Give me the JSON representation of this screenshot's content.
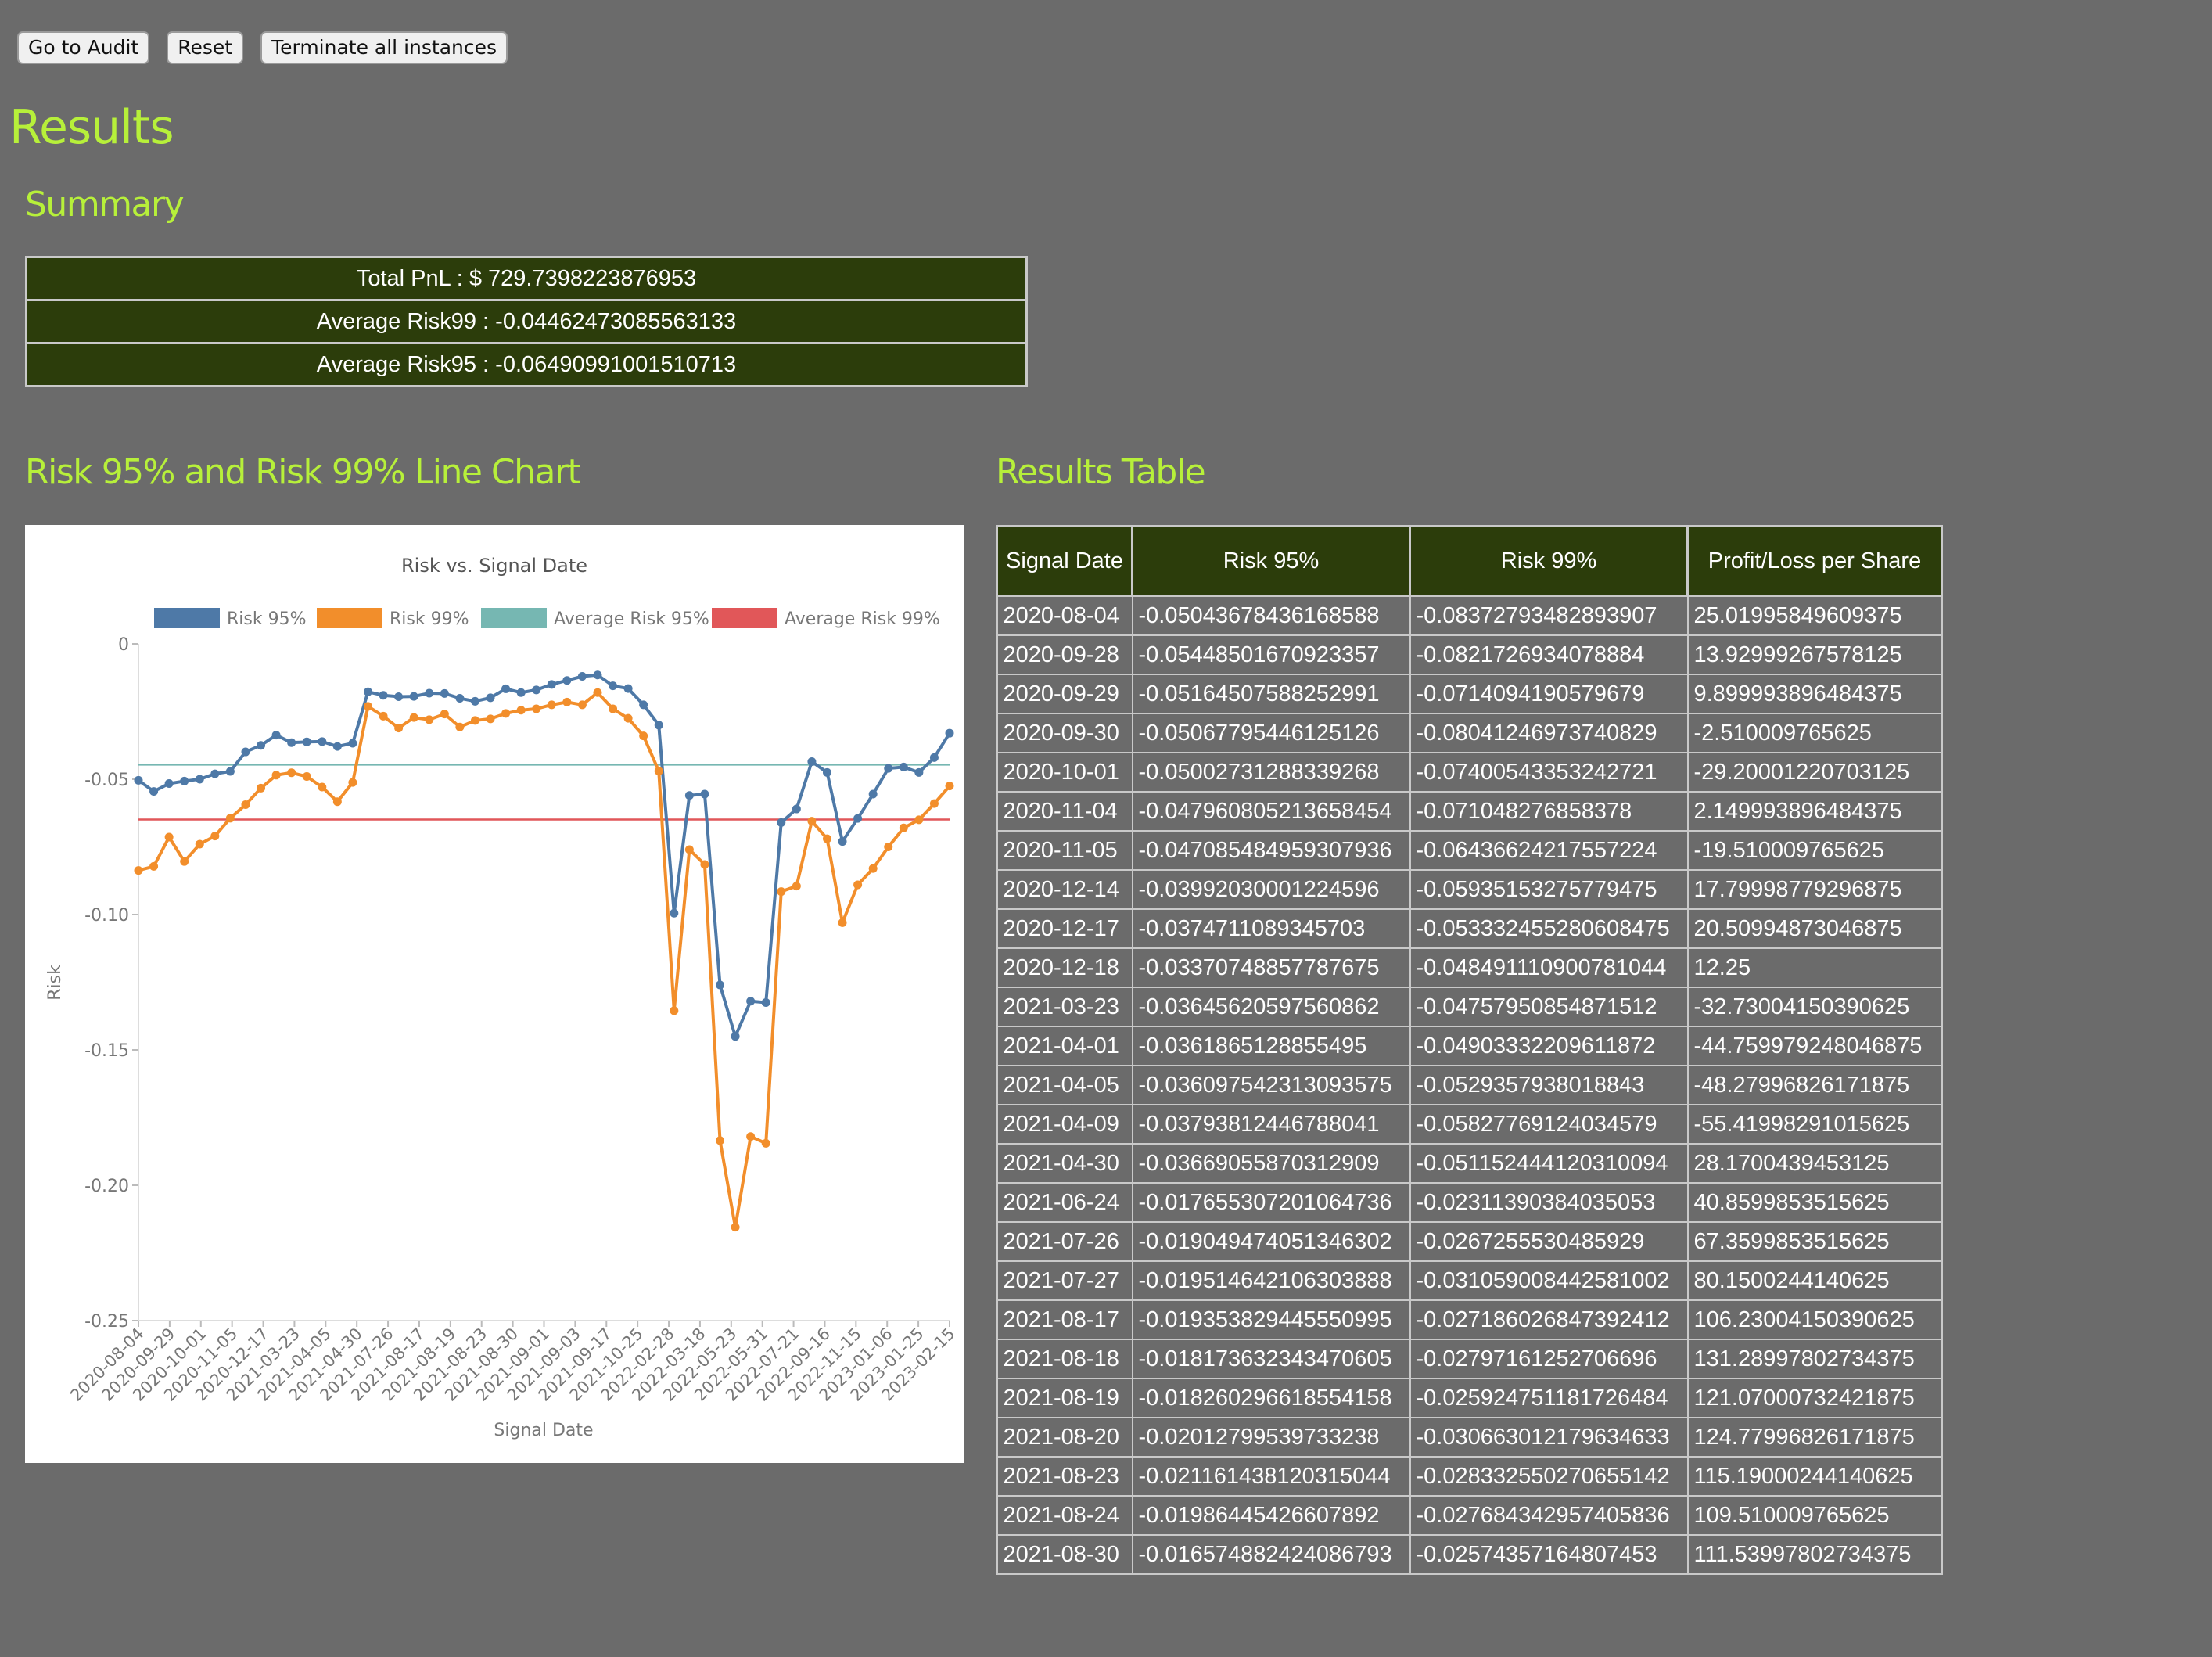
{
  "toolbar": {
    "audit_label": "Go to Audit",
    "reset_label": "Reset",
    "terminate_label": "Terminate all instances"
  },
  "page_title": "Results",
  "summary": {
    "heading": "Summary",
    "total_pnl": "Total PnL : $ 729.7398223876953",
    "avg_risk99": "Average Risk99 : -0.04462473085563133",
    "avg_risk95": "Average Risk95 : -0.06490991001510713"
  },
  "chart_section": {
    "heading": "Risk 95% and Risk 99% Line Chart"
  },
  "table_section": {
    "heading": "Results Table"
  },
  "table": {
    "headers": [
      "Signal Date",
      "Risk 95%",
      "Risk 99%",
      "Profit/Loss per Share"
    ],
    "rows": [
      [
        "2020-08-04",
        "-0.05043678436168588",
        "-0.08372793482893907",
        "25.01995849609375"
      ],
      [
        "2020-09-28",
        "-0.05448501670923357",
        "-0.0821726934078884",
        "13.92999267578125"
      ],
      [
        "2020-09-29",
        "-0.05164507588252991",
        "-0.0714094190579679",
        "9.899993896484375"
      ],
      [
        "2020-09-30",
        "-0.05067795446125126",
        "-0.08041246973740829",
        "-2.510009765625"
      ],
      [
        "2020-10-01",
        "-0.05002731288339268",
        "-0.07400543353242721",
        "-29.20001220703125"
      ],
      [
        "2020-11-04",
        "-0.047960805213658454",
        "-0.071048276858378",
        "2.149993896484375"
      ],
      [
        "2020-11-05",
        "-0.047085484959307936",
        "-0.06436624217557224",
        "-19.510009765625"
      ],
      [
        "2020-12-14",
        "-0.03992030001224596",
        "-0.05935153275779475",
        "17.79998779296875"
      ],
      [
        "2020-12-17",
        "-0.0374711089345703",
        "-0.053332455280608475",
        "20.50994873046875"
      ],
      [
        "2020-12-18",
        "-0.03370748857787675",
        "-0.048491110900781044",
        "12.25"
      ],
      [
        "2021-03-23",
        "-0.03645620597560862",
        "-0.04757950854871512",
        "-32.73004150390625"
      ],
      [
        "2021-04-01",
        "-0.0361865128855495",
        "-0.04903332209611872",
        "-44.759979248046875"
      ],
      [
        "2021-04-05",
        "-0.036097542313093575",
        "-0.0529357938018843",
        "-48.27996826171875"
      ],
      [
        "2021-04-09",
        "-0.03793812446788041",
        "-0.05827769124034579",
        "-55.41998291015625"
      ],
      [
        "2021-04-30",
        "-0.03669055870312909",
        "-0.051152444120310094",
        "28.1700439453125"
      ],
      [
        "2021-06-24",
        "-0.017655307201064736",
        "-0.02311390384035053",
        "40.8599853515625"
      ],
      [
        "2021-07-26",
        "-0.019049474051346302",
        "-0.0267255530485929",
        "67.3599853515625"
      ],
      [
        "2021-07-27",
        "-0.019514642106303888",
        "-0.031059008442581002",
        "80.1500244140625"
      ],
      [
        "2021-08-17",
        "-0.019353829445550995",
        "-0.027186026847392412",
        "106.23004150390625"
      ],
      [
        "2021-08-18",
        "-0.018173632343470605",
        "-0.02797161252706696",
        "131.28997802734375"
      ],
      [
        "2021-08-19",
        "-0.018260296618554158",
        "-0.025924751181726484",
        "121.07000732421875"
      ],
      [
        "2021-08-20",
        "-0.02012799539733238",
        "-0.030663012179634633",
        "124.77996826171875"
      ],
      [
        "2021-08-23",
        "-0.021161438120315044",
        "-0.028332550270655142",
        "115.19000244140625"
      ],
      [
        "2021-08-24",
        "-0.01986445426607892",
        "-0.027684342957405836",
        "109.510009765625"
      ],
      [
        "2021-08-30",
        "-0.016574882424086793",
        "-0.02574357164807453",
        "111.53997802734375"
      ]
    ]
  },
  "chart_data": {
    "type": "line",
    "title": "Risk vs. Signal Date",
    "xlabel": "Signal Date",
    "ylabel": "Risk",
    "ylim": [
      -0.25,
      0
    ],
    "yticks": [
      "0",
      "-0.05",
      "-0.10",
      "-0.15",
      "-0.20",
      "-0.25"
    ],
    "ytick_values": [
      0,
      -0.05,
      -0.1,
      -0.15,
      -0.2,
      -0.25
    ],
    "legend_position": "top",
    "grid": false,
    "x_tick_labels": [
      "2020-08-04",
      "2020-09-29",
      "2020-10-01",
      "2020-11-05",
      "2020-12-17",
      "2021-03-23",
      "2021-04-05",
      "2021-04-30",
      "2021-07-26",
      "2021-08-17",
      "2021-08-19",
      "2021-08-23",
      "2021-08-30",
      "2021-09-01",
      "2021-09-03",
      "2021-09-17",
      "2021-10-25",
      "2022-02-28",
      "2022-03-18",
      "2022-05-23",
      "2022-05-31",
      "2022-07-21",
      "2022-09-16",
      "2022-11-15",
      "2023-01-06",
      "2023-01-25",
      "2023-02-15"
    ],
    "series": [
      {
        "name": "Risk 95%",
        "color": "#4e79a7",
        "values": [
          -0.0504,
          -0.0545,
          -0.0516,
          -0.0507,
          -0.05,
          -0.048,
          -0.0471,
          -0.0399,
          -0.0375,
          -0.0337,
          -0.0365,
          -0.0362,
          -0.0361,
          -0.0379,
          -0.0367,
          -0.0177,
          -0.019,
          -0.0195,
          -0.0194,
          -0.0182,
          -0.0183,
          -0.0201,
          -0.0212,
          -0.0199,
          -0.0166,
          -0.018,
          -0.017,
          -0.015,
          -0.0135,
          -0.012,
          -0.0115,
          -0.0155,
          -0.0165,
          -0.0225,
          -0.03,
          -0.0995,
          -0.056,
          -0.0555,
          -0.126,
          -0.145,
          -0.132,
          -0.1325,
          -0.066,
          -0.061,
          -0.0435,
          -0.0475,
          -0.073,
          -0.0645,
          -0.0555,
          -0.046,
          -0.0455,
          -0.0475,
          -0.042,
          -0.033
        ]
      },
      {
        "name": "Risk 99%",
        "color": "#f28e2b",
        "values": [
          -0.0837,
          -0.0822,
          -0.0714,
          -0.0804,
          -0.074,
          -0.071,
          -0.0644,
          -0.0594,
          -0.0533,
          -0.0485,
          -0.0476,
          -0.049,
          -0.0529,
          -0.0583,
          -0.0512,
          -0.0231,
          -0.0267,
          -0.0311,
          -0.0272,
          -0.028,
          -0.0259,
          -0.0307,
          -0.0283,
          -0.0277,
          -0.0257,
          -0.0245,
          -0.024,
          -0.0225,
          -0.0215,
          -0.0225,
          -0.018,
          -0.024,
          -0.0275,
          -0.034,
          -0.047,
          -0.1355,
          -0.076,
          -0.0815,
          -0.1835,
          -0.2155,
          -0.182,
          -0.1845,
          -0.0915,
          -0.0895,
          -0.0655,
          -0.072,
          -0.103,
          -0.089,
          -0.083,
          -0.075,
          -0.068,
          -0.065,
          -0.059,
          -0.0525
        ]
      },
      {
        "name": "Average Risk 95%",
        "color": "#76b7b2",
        "constant": -0.0446
      },
      {
        "name": "Average Risk 99%",
        "color": "#e15759",
        "constant": -0.0649
      }
    ]
  }
}
